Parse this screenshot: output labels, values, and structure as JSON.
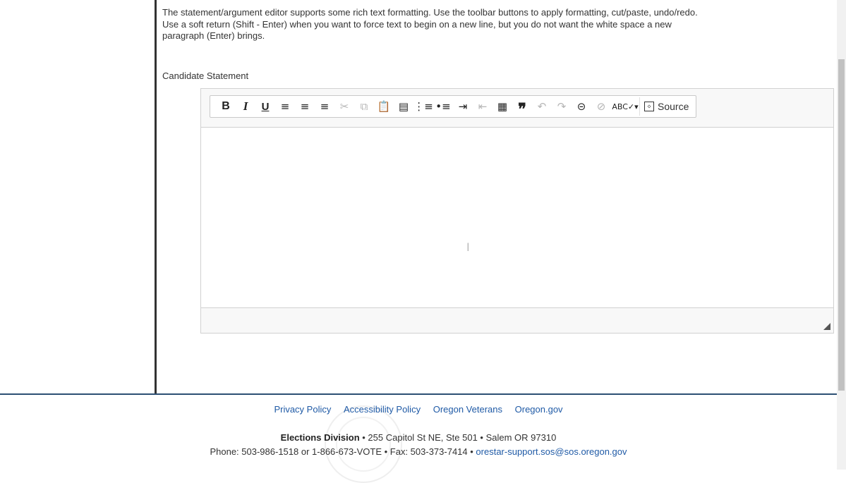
{
  "intro": {
    "line1": "The statement/argument editor supports some rich text formatting. Use the toolbar buttons to apply formatting, cut/paste, undo/redo.",
    "line2": "Use a soft return (Shift - Enter) when you want to force text to begin on a new line, but you do not want the white space a new",
    "line3": "paragraph (Enter) brings."
  },
  "field_label": "Candidate Statement",
  "toolbar": {
    "bold": "B",
    "italic": "I",
    "underline": "U",
    "align_left": "≡",
    "align_center": "≡",
    "align_right": "≡",
    "cut": "✂",
    "copy": "⧉",
    "paste": "📋",
    "paste_text": "▤",
    "numbered_list": "⋮≡",
    "bulleted_list": "•≡",
    "indent": "⇥",
    "outdent": "⇤",
    "table": "▦",
    "blockquote": "❞",
    "undo": "↶",
    "redo": "↷",
    "link": "⊝",
    "unlink": "⊘",
    "spellcheck": "ABC✓▾",
    "source_label": "Source",
    "source_glyph": "◇"
  },
  "footer": {
    "links": [
      "Privacy Policy",
      "Accessibility Policy",
      "Oregon Veterans",
      "Oregon.gov"
    ],
    "division": "Elections Division",
    "address": " • 255 Capitol St NE, Ste 501 • Salem OR 97310",
    "phone": "Phone: 503-986-1518 or 1-866-673-VOTE • Fax: 503-373-7414 • ",
    "email": "orestar-support.sos@sos.oregon.gov"
  },
  "colors": {
    "link": "#1f5aa6",
    "footer_rule": "#2c4f73",
    "text": "#333333"
  }
}
